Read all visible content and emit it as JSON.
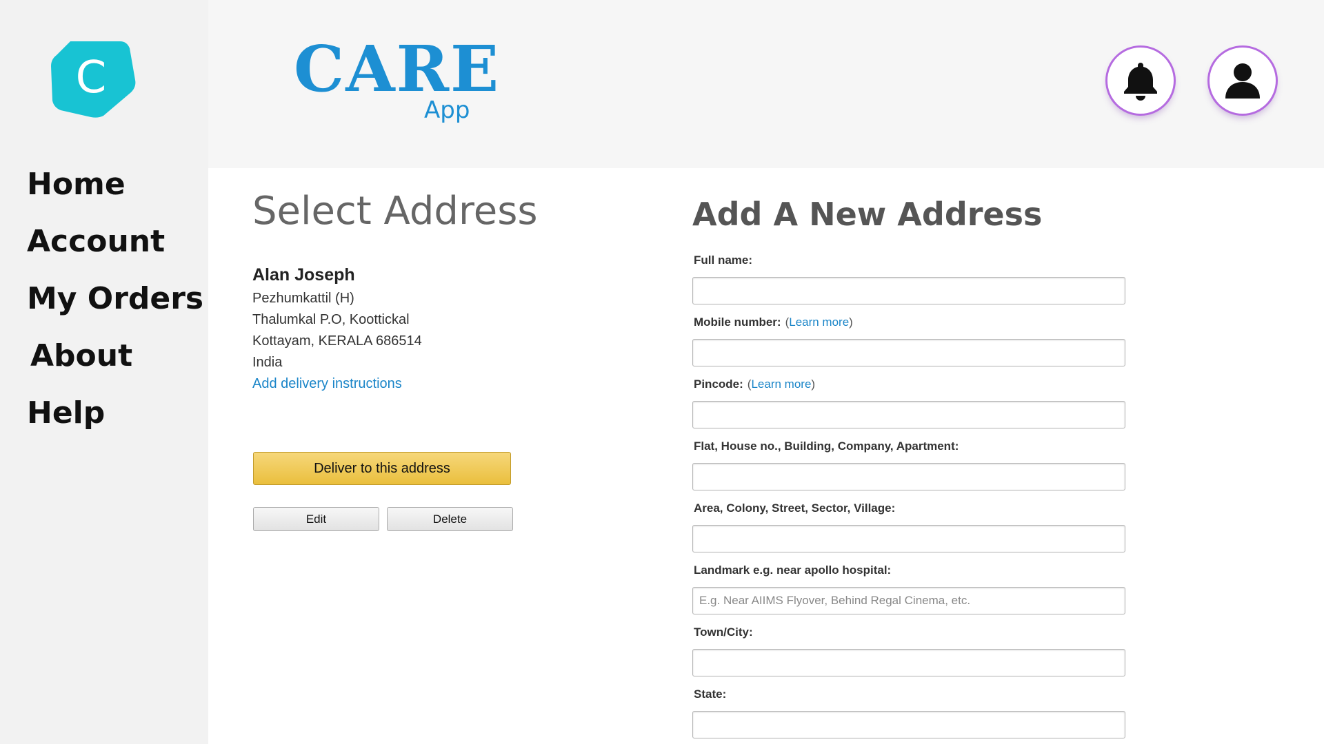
{
  "app": {
    "brand_title": "CARE",
    "brand_subtitle": "App",
    "logo_letter": "C",
    "accent_color": "#1d8fd3",
    "logo_color": "#18c3d3"
  },
  "sidebar": {
    "items": [
      {
        "label": "Home"
      },
      {
        "label": "Account"
      },
      {
        "label": "My Orders"
      },
      {
        "label": "About"
      },
      {
        "label": "Help"
      }
    ]
  },
  "header": {
    "icons": [
      "bell-icon",
      "user-icon"
    ]
  },
  "select_address": {
    "title": "Select Address",
    "name": "Alan Joseph",
    "lines": [
      "Pezhumkattil (H)",
      "Thalumkal P.O, Koottickal",
      "Kottayam, KERALA 686514",
      "India"
    ],
    "instructions_link": "Add delivery instructions",
    "deliver_label": "Deliver to this address",
    "edit_label": "Edit",
    "delete_label": "Delete"
  },
  "new_address": {
    "title": "Add A New Address",
    "learn_more": "Learn more",
    "fields": [
      {
        "label": "Full name:",
        "value": "",
        "placeholder": ""
      },
      {
        "label": "Mobile number:",
        "value": "",
        "placeholder": ""
      },
      {
        "label": "Pincode:",
        "value": "",
        "placeholder": ""
      },
      {
        "label": "Flat, House no., Building, Company, Apartment:",
        "value": "",
        "placeholder": ""
      },
      {
        "label": "Area, Colony, Street, Sector, Village:",
        "value": "",
        "placeholder": ""
      },
      {
        "label": "Landmark e.g. near apollo hospital:",
        "value": "",
        "placeholder": "E.g. Near AIIMS Flyover, Behind Regal Cinema, etc."
      },
      {
        "label": "Town/City:",
        "value": "",
        "placeholder": ""
      },
      {
        "label": "State:",
        "value": "",
        "placeholder": ""
      }
    ]
  }
}
